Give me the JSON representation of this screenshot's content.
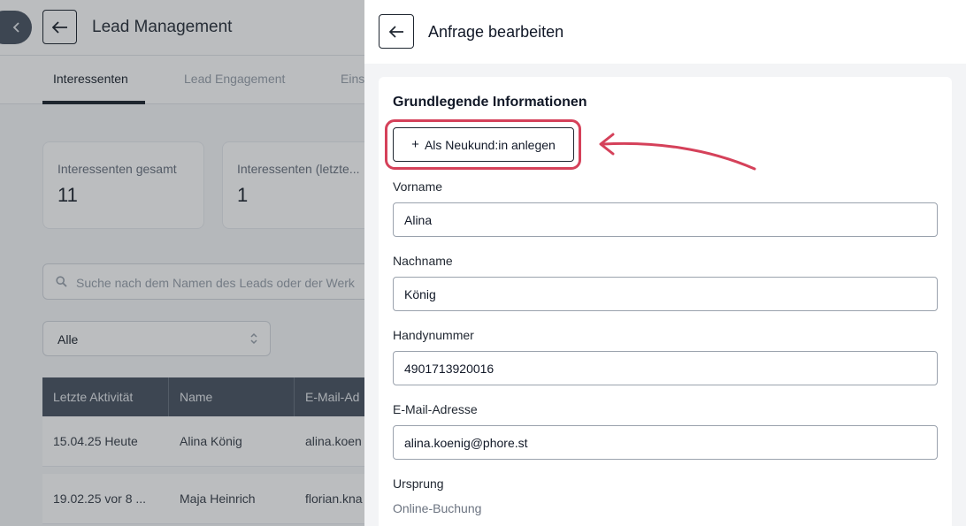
{
  "background": {
    "title": "Lead Management",
    "tabs": [
      {
        "label": "Interessenten",
        "active": true
      },
      {
        "label": "Lead Engagement",
        "active": false
      },
      {
        "label": "Eins",
        "active": false
      }
    ],
    "stats": [
      {
        "label": "Interessenten gesamt",
        "value": "11"
      },
      {
        "label": "Interessenten (letzte...",
        "value": "1"
      }
    ],
    "search_placeholder": "Suche nach dem Namen des Leads oder der Werk",
    "filter_value": "Alle",
    "table": {
      "columns": [
        "Letzte Aktivität",
        "Name",
        "E-Mail-Ad"
      ],
      "rows": [
        [
          "15.04.25 Heute",
          "Alina König",
          "alina.koen"
        ],
        [
          "19.02.25 vor 8 ...",
          "Maja Heinrich",
          "florian.kna"
        ]
      ]
    }
  },
  "drawer": {
    "title": "Anfrage bearbeiten",
    "section_title": "Grundlegende Informationen",
    "new_customer_button": "Als Neukund:in anlegen",
    "fields": {
      "first_name": {
        "label": "Vorname",
        "value": "Alina"
      },
      "last_name": {
        "label": "Nachname",
        "value": "König"
      },
      "phone": {
        "label": "Handynummer",
        "value": "4901713920016"
      },
      "email": {
        "label": "E-Mail-Adresse",
        "value": "alina.koenig@phore.st"
      },
      "origin": {
        "label": "Ursprung",
        "value": "Online-Buchung"
      }
    }
  },
  "colors": {
    "highlight": "#d5415a",
    "table_header": "#4b5563",
    "overlay": "rgba(30,36,44,0.30)"
  }
}
